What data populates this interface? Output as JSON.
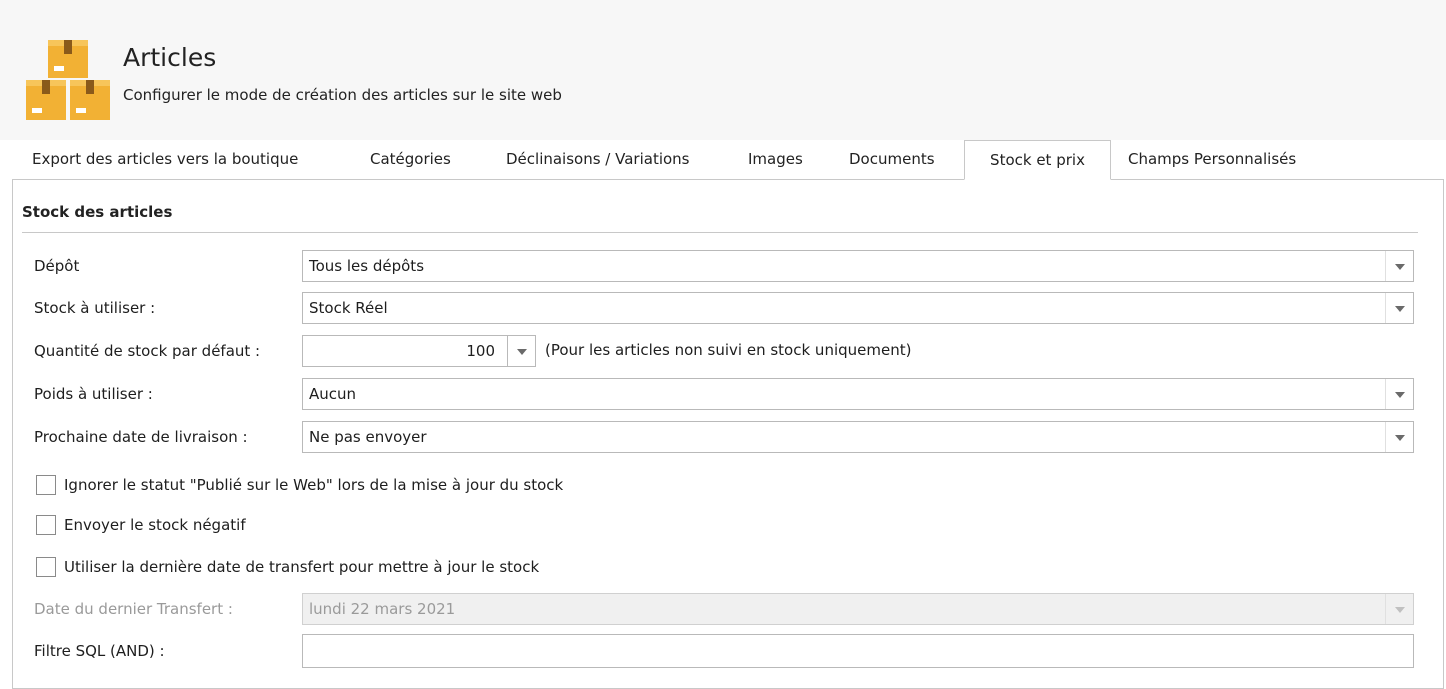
{
  "header": {
    "title": "Articles",
    "subtitle": "Configurer le mode de création des articles sur le site web",
    "icon": "boxes-icon"
  },
  "tabs": [
    {
      "label": "Export des articles vers la boutique",
      "active": false
    },
    {
      "label": "Catégories",
      "active": false
    },
    {
      "label": "Déclinaisons / Variations",
      "active": false
    },
    {
      "label": "Images",
      "active": false
    },
    {
      "label": "Documents",
      "active": false
    },
    {
      "label": "Stock et prix",
      "active": true
    },
    {
      "label": "Champs Personnalisés",
      "active": false
    }
  ],
  "section": {
    "title": "Stock des articles"
  },
  "fields": {
    "depot": {
      "label": "Dépôt",
      "value": "Tous les dépôts"
    },
    "stock": {
      "label": "Stock à utiliser :",
      "value": "Stock Réel"
    },
    "quantite": {
      "label": "Quantité de stock par défaut :",
      "value": "100",
      "hint": "(Pour les articles non suivi en stock uniquement)"
    },
    "poids": {
      "label": "Poids à utiliser :",
      "value": "Aucun"
    },
    "livraison": {
      "label": "Prochaine date de livraison :",
      "value": "Ne pas envoyer"
    },
    "date_transfert": {
      "label": "Date du dernier Transfert :",
      "value": "lundi 22 mars 2021",
      "disabled": true
    },
    "filtre_sql": {
      "label": "Filtre SQL (AND) :",
      "value": ""
    }
  },
  "checkboxes": {
    "ignorer": {
      "label": "Ignorer le statut \"Publié sur le Web\" lors de la mise à jour du stock",
      "checked": false
    },
    "negatif": {
      "label": "Envoyer le stock négatif",
      "checked": false
    },
    "derniere_date": {
      "label": "Utiliser la dernière date de transfert pour mettre à jour le stock",
      "checked": false
    }
  },
  "colors": {
    "box": "#f2b134",
    "box_dark": "#d9962a",
    "border": "#c8c8c8"
  }
}
